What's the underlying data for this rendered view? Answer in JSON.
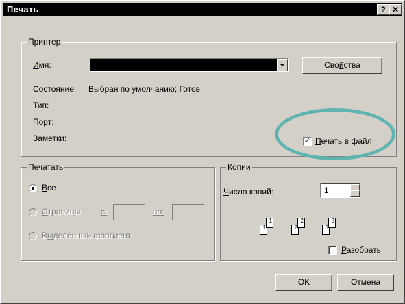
{
  "window": {
    "title": "Печать",
    "help_label": "?",
    "close_label": "✕"
  },
  "printer": {
    "group_label": "Принтер",
    "name_label_u": "И",
    "name_label_rest": "мя:",
    "properties_label_pre": "Сво",
    "properties_label_u": "й",
    "properties_label_post": "ства",
    "status_label": "Состояние:",
    "status_value": "Выбран по умолчанию; Готов",
    "type_label": "Тип:",
    "port_label": "Порт:",
    "notes_label": "Заметки:",
    "print_to_file_u": "П",
    "print_to_file_rest": "ечать в файл",
    "print_to_file_checked": true
  },
  "print_range": {
    "group_label": "Печатать",
    "all_label_u": "В",
    "all_label_rest": "се",
    "pages_label_u": "С",
    "pages_label_rest": "траницы",
    "from_label": "с:",
    "to_label": "по:",
    "selection_label_pre": "В",
    "selection_label_u": "ы",
    "selection_label_post": "деленный фрагмент"
  },
  "copies": {
    "group_label": "Копии",
    "count_label_u": "Ч",
    "count_label_rest": "исло копий:",
    "count_value": "1",
    "collate_u": "Р",
    "collate_rest": "азобрать",
    "collate_checked": false,
    "page_digits": [
      "1",
      "1",
      "2",
      "2",
      "3",
      "3"
    ]
  },
  "buttons": {
    "ok": "OK",
    "cancel": "Отмена"
  },
  "icons": {
    "checkmark": "✓"
  }
}
